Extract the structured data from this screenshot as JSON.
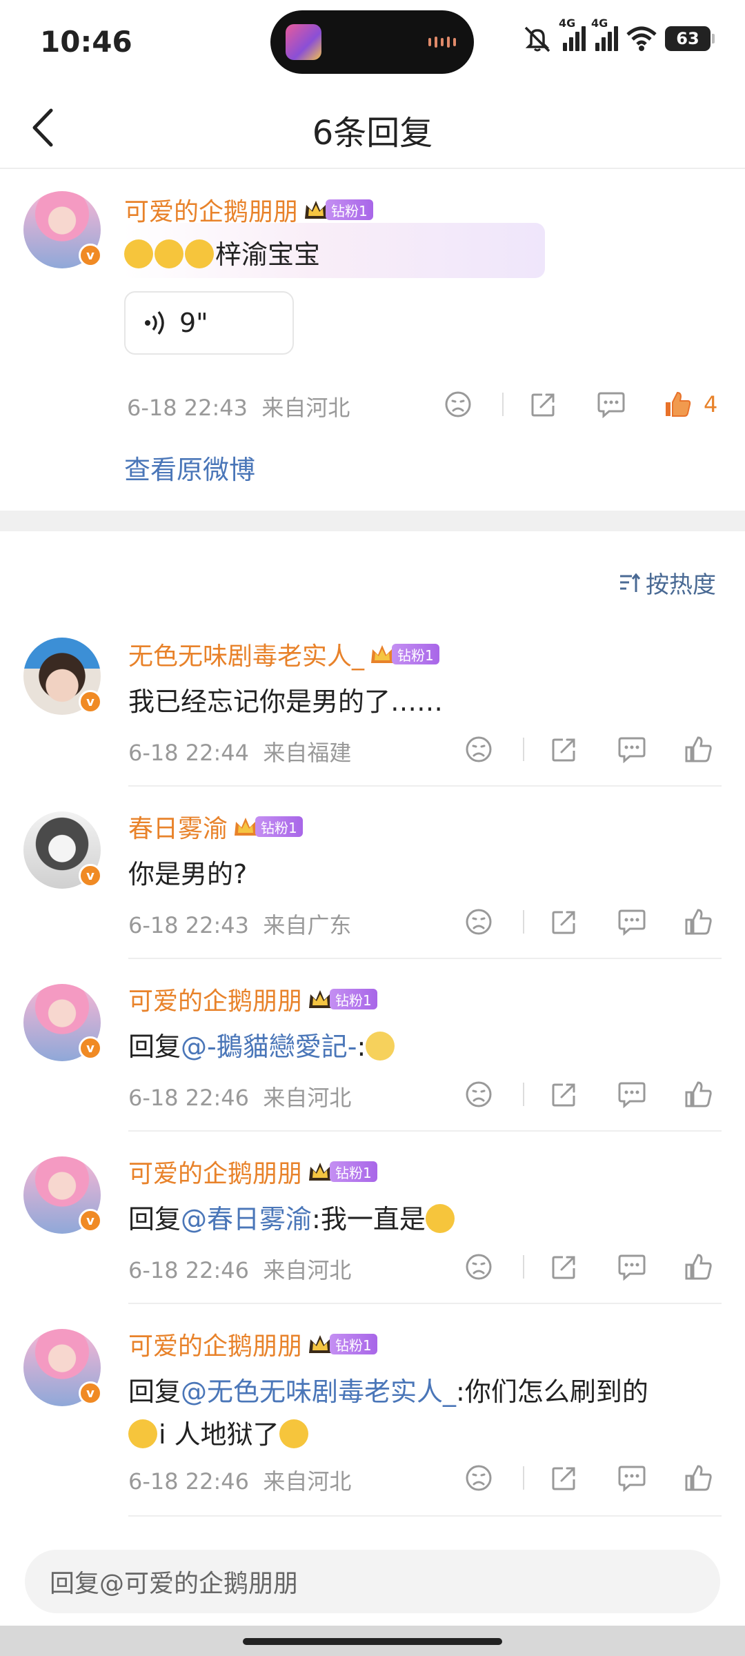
{
  "status_bar": {
    "time": "10:46",
    "net1": "4G",
    "net2": "4G",
    "battery": "63"
  },
  "nav": {
    "title": "6条回复"
  },
  "root_comment": {
    "username": "可爱的企鹅朋朋",
    "fan_badge": "钻粉1",
    "text": "梓渝宝宝",
    "voice_length": "9\"",
    "timestamp": "6-18 22:43",
    "location": "来自河北",
    "like_count": "4",
    "view_original": "查看原微博"
  },
  "sort": {
    "label": "按热度"
  },
  "replies": [
    {
      "username": "无色无味剧毒老实人_",
      "fan_badge": "钻粉1",
      "text": "我已经忘记你是男的了……",
      "timestamp": "6-18 22:44",
      "location": "来自福建"
    },
    {
      "username": "春日雾渝",
      "fan_badge": "钻粉1",
      "text": "你是男的?",
      "timestamp": "6-18 22:43",
      "location": "来自广东"
    },
    {
      "username": "可爱的企鹅朋朋",
      "fan_badge": "钻粉1",
      "prefix": "回复",
      "mention": "@-鵝貓戀愛記-",
      "text": ":",
      "timestamp": "6-18 22:46",
      "location": "来自河北"
    },
    {
      "username": "可爱的企鹅朋朋",
      "fan_badge": "钻粉1",
      "prefix": "回复",
      "mention": "@春日雾渝",
      "text": ":我一直是",
      "timestamp": "6-18 22:46",
      "location": "来自河北"
    },
    {
      "username": "可爱的企鹅朋朋",
      "fan_badge": "钻粉1",
      "prefix": "回复",
      "mention": "@无色无味剧毒老实人_",
      "text": ":你们怎么刷到的",
      "text_line2": "i 人地狱了",
      "timestamp": "6-18 22:46",
      "location": "来自河北"
    }
  ],
  "reply_input": {
    "placeholder": "回复@可爱的企鹅朋朋"
  },
  "colors": {
    "username": "#e8822a",
    "mention": "#4a76b8",
    "meta": "#999999",
    "badge": "#b277ec"
  }
}
